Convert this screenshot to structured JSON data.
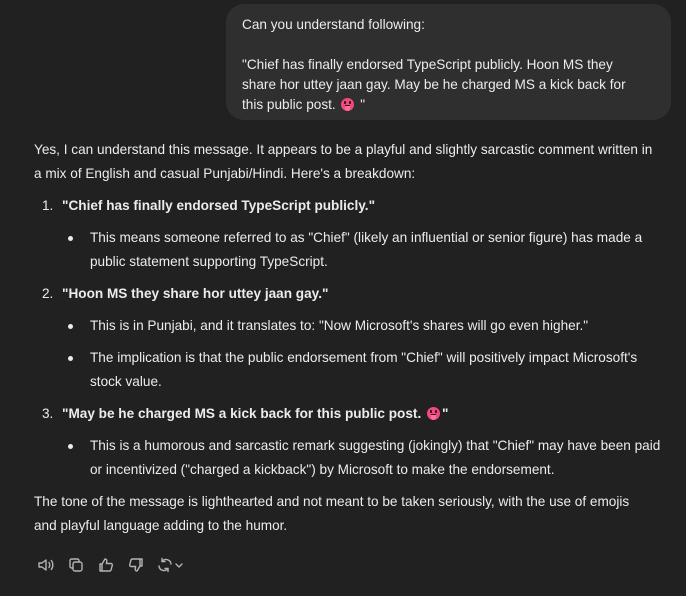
{
  "user_message": {
    "line1": "Can you understand following:",
    "quote_line1": "\"Chief has finally endorsed TypeScript publicly. Hoon MS they",
    "quote_line2": "share hor uttey jaan gay. May be he charged MS a kick back for",
    "quote_line3_before": "this public post.",
    "quote_line3_after": "\""
  },
  "assistant_message": {
    "intro_line1": "Yes, I can understand this message. It appears to be a playful and slightly sarcastic comment written in",
    "intro_line2": "a mix of English and casual Punjabi/Hindi. Here's a breakdown:",
    "items": [
      {
        "number": "1.",
        "title": "\"Chief has finally endorsed TypeScript publicly.\"",
        "bullets": [
          {
            "line1": "This means someone referred to as \"Chief\" (likely an influential or senior figure) has made a",
            "line2": "public statement supporting TypeScript."
          }
        ]
      },
      {
        "number": "2.",
        "title": "\"Hoon MS they share hor uttey jaan gay.\"",
        "bullets": [
          {
            "line1": "This is in Punjabi, and it translates to: \"Now Microsoft's shares will go even higher.\""
          },
          {
            "line1": "The implication is that the public endorsement from \"Chief\" will positively impact Microsoft's",
            "line2": "stock value."
          }
        ]
      },
      {
        "number": "3.",
        "title_before": "\"May be he charged MS a kick back for this public post.",
        "title_after": "\"",
        "bullets": [
          {
            "line1": "This is a humorous and sarcastic remark suggesting (jokingly) that \"Chief\" may have been paid",
            "line2": "or incentivized (\"charged a kickback\") by Microsoft to make the endorsement."
          }
        ]
      }
    ],
    "outro_line1": "The tone of the message is lighthearted and not meant to be taken seriously, with the use of emojis",
    "outro_line2": "and playful language adding to the humor."
  },
  "actions": [
    "read-aloud-icon",
    "copy-icon",
    "thumbs-up-icon",
    "thumbs-down-icon",
    "regenerate-icon"
  ],
  "colors": {
    "background": "#212121",
    "user_bubble": "#2f2f2f",
    "text": "#ececec",
    "icon": "#b4b4b4",
    "emoji": "#f3487e"
  }
}
